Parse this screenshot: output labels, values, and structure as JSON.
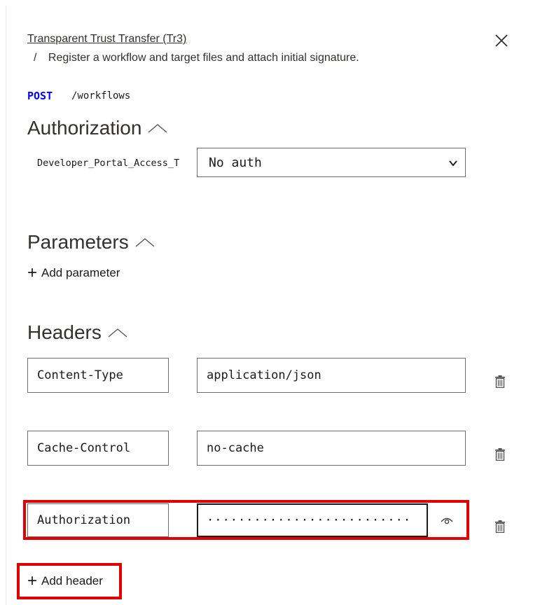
{
  "header": {
    "api_name": "Transparent Trust Transfer (Tr3)",
    "separator": "/",
    "operation": "Register a workflow and target files and attach initial signature."
  },
  "request": {
    "method": "POST",
    "path": "/workflows"
  },
  "authorization": {
    "title": "Authorization",
    "server_label": "Developer_Portal_Access_T",
    "selected_value": "No auth"
  },
  "parameters": {
    "title": "Parameters",
    "add_label": "Add parameter"
  },
  "headers": {
    "title": "Headers",
    "rows": [
      {
        "name": "Content-Type",
        "value": "application/json"
      },
      {
        "name": "Cache-Control",
        "value": "no-cache"
      },
      {
        "name": "Authorization",
        "value": "··························"
      }
    ],
    "add_label": "Add header"
  },
  "colors": {
    "method": "#0000ff",
    "highlight": "#e00000",
    "border": "#6b6b6b"
  },
  "icons": {
    "close": "close-icon",
    "collapse": "chevron-up-icon",
    "dropdown": "chevron-down-icon",
    "delete": "trash-icon",
    "reveal": "eye-icon",
    "add": "plus-icon"
  }
}
